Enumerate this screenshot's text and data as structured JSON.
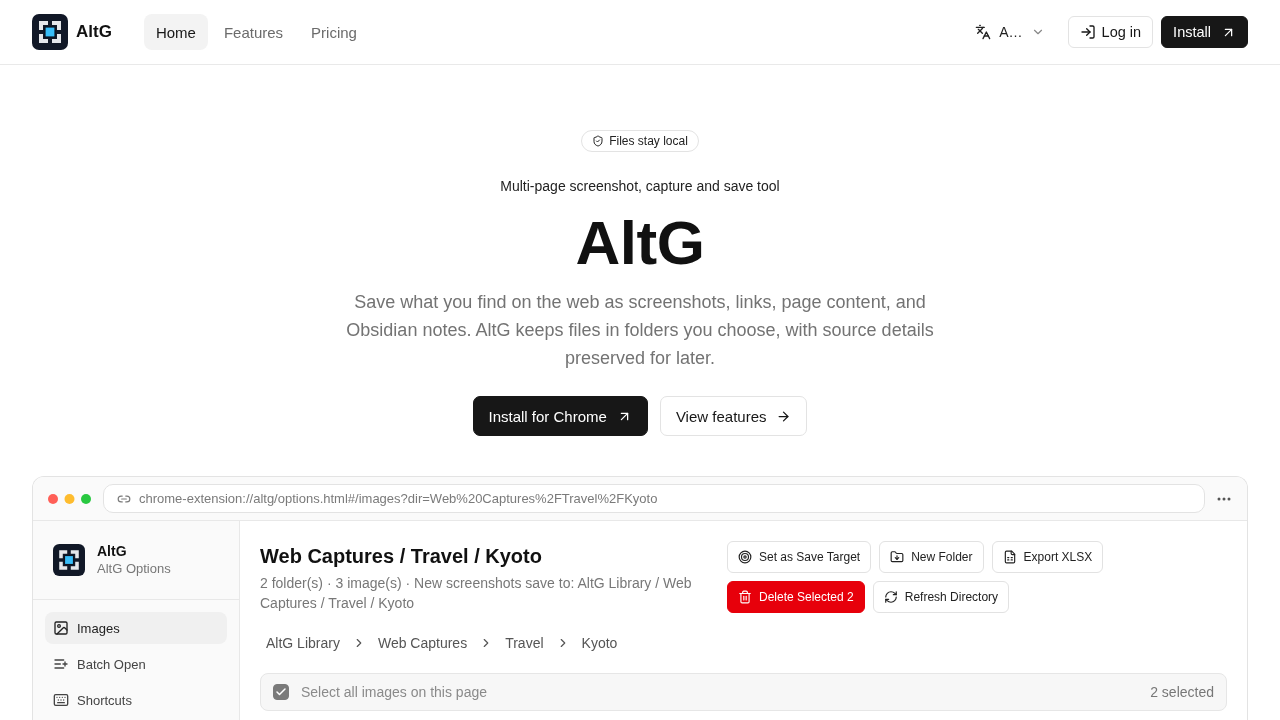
{
  "nav": {
    "brand": "AltG",
    "links": [
      {
        "label": "Home",
        "selected": true
      },
      {
        "label": "Features",
        "selected": false
      },
      {
        "label": "Pricing",
        "selected": false
      }
    ],
    "language": "A…",
    "login": "Log in",
    "install": "Install"
  },
  "hero": {
    "badge": "Files stay local",
    "tagline": "Multi-page screenshot, capture and save tool",
    "title": "AltG",
    "description": "Save what you find on the web as screenshots, links, page content, and Obsidian notes. AltG keeps files in folders you choose, with source details preserved for later.",
    "buttons": [
      {
        "label": "Install for Chrome",
        "kind": "primary"
      },
      {
        "label": "View features",
        "kind": "secondary"
      }
    ]
  },
  "preview": {
    "address": "chrome-extension://altg/options.html#/images?dir=Web%20Captures%2FTravel%2FKyoto",
    "sidebar": {
      "app_name": "AltG",
      "app_subtitle": "AltG Options",
      "items": [
        {
          "label": "Images",
          "selected": true
        },
        {
          "label": "Batch Open",
          "selected": false
        },
        {
          "label": "Shortcuts",
          "selected": false
        }
      ]
    },
    "main": {
      "title": "Web Captures / Travel / Kyoto",
      "summary": "2 folder(s) · 3 image(s) · New screenshots save to: AltG Library / Web Captures / Travel / Kyoto",
      "actions": [
        {
          "label": "Set as Save Target",
          "kind": "default"
        },
        {
          "label": "New Folder",
          "kind": "default"
        },
        {
          "label": "Export XLSX",
          "kind": "default"
        },
        {
          "label": "Delete Selected 2",
          "kind": "danger"
        },
        {
          "label": "Refresh Directory",
          "kind": "default"
        }
      ],
      "breadcrumb": [
        "AltG Library",
        "Web Captures",
        "Travel",
        "Kyoto"
      ],
      "select_all": {
        "label": "Select all images on this page",
        "checked": true
      },
      "selected_count": "2 selected"
    }
  }
}
